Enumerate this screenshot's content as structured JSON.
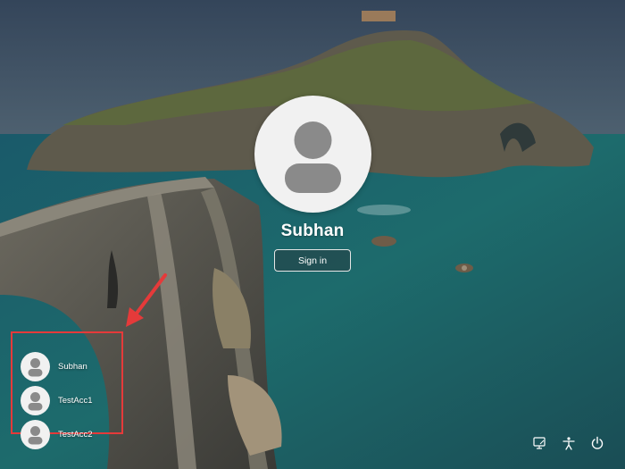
{
  "main_user": {
    "name": "Subhan",
    "sign_in_label": "Sign in"
  },
  "other_users": [
    {
      "name": "Subhan"
    },
    {
      "name": "TestAcc1"
    },
    {
      "name": "TestAcc2"
    }
  ],
  "bottom_right_icons": [
    "network-icon",
    "accessibility-icon",
    "power-icon"
  ],
  "colors": {
    "annotation": "#e53a3a",
    "avatar_bg": "#f1f1f1",
    "avatar_glyph": "#8a8a8a",
    "text": "#ffffff"
  }
}
